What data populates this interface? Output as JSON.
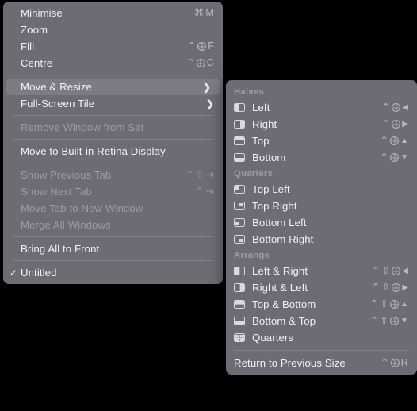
{
  "main_menu": {
    "groups": [
      {
        "items": [
          {
            "label": "Minimise",
            "shortcut": [
              "cmd",
              "M"
            ],
            "disabled": false,
            "checked": false,
            "submenu": false,
            "highlighted": false
          },
          {
            "label": "Zoom",
            "shortcut": [],
            "disabled": false,
            "checked": false,
            "submenu": false,
            "highlighted": false
          },
          {
            "label": "Fill",
            "shortcut": [
              "ctrl",
              "globe",
              "F"
            ],
            "disabled": false,
            "checked": false,
            "submenu": false,
            "highlighted": false
          },
          {
            "label": "Centre",
            "shortcut": [
              "ctrl",
              "globe",
              "C"
            ],
            "disabled": false,
            "checked": false,
            "submenu": false,
            "highlighted": false
          }
        ]
      },
      {
        "items": [
          {
            "label": "Move & Resize",
            "shortcut": [],
            "disabled": false,
            "checked": false,
            "submenu": true,
            "highlighted": true
          },
          {
            "label": "Full-Screen Tile",
            "shortcut": [],
            "disabled": false,
            "checked": false,
            "submenu": true,
            "highlighted": false
          }
        ]
      },
      {
        "items": [
          {
            "label": "Remove Window from Set",
            "shortcut": [],
            "disabled": true,
            "checked": false,
            "submenu": false,
            "highlighted": false
          }
        ]
      },
      {
        "items": [
          {
            "label": "Move to Built-in Retina Display",
            "shortcut": [],
            "disabled": false,
            "checked": false,
            "submenu": false,
            "highlighted": false
          }
        ]
      },
      {
        "items": [
          {
            "label": "Show Previous Tab",
            "shortcut": [
              "ctrl",
              "shift",
              "tab"
            ],
            "disabled": true,
            "checked": false,
            "submenu": false,
            "highlighted": false
          },
          {
            "label": "Show Next Tab",
            "shortcut": [
              "ctrl",
              "tab"
            ],
            "disabled": true,
            "checked": false,
            "submenu": false,
            "highlighted": false
          },
          {
            "label": "Move Tab to New Window",
            "shortcut": [],
            "disabled": true,
            "checked": false,
            "submenu": false,
            "highlighted": false
          },
          {
            "label": "Merge All Windows",
            "shortcut": [],
            "disabled": true,
            "checked": false,
            "submenu": false,
            "highlighted": false
          }
        ]
      },
      {
        "items": [
          {
            "label": "Bring All to Front",
            "shortcut": [],
            "disabled": false,
            "checked": false,
            "submenu": false,
            "highlighted": false
          }
        ]
      },
      {
        "items": [
          {
            "label": "Untitled",
            "shortcut": [],
            "disabled": false,
            "checked": true,
            "submenu": false,
            "highlighted": false
          }
        ]
      }
    ]
  },
  "submenu": {
    "sections": [
      {
        "header": "Halves",
        "items": [
          {
            "label": "Left",
            "icon": "window-left-half-icon",
            "shortcut": [
              "ctrl",
              "globe",
              "left"
            ]
          },
          {
            "label": "Right",
            "icon": "window-right-half-icon",
            "shortcut": [
              "ctrl",
              "globe",
              "right"
            ]
          },
          {
            "label": "Top",
            "icon": "window-top-half-icon",
            "shortcut": [
              "ctrl",
              "globe",
              "up"
            ]
          },
          {
            "label": "Bottom",
            "icon": "window-bottom-half-icon",
            "shortcut": [
              "ctrl",
              "globe",
              "down"
            ]
          }
        ]
      },
      {
        "header": "Quarters",
        "items": [
          {
            "label": "Top Left",
            "icon": "window-top-left-quarter-icon",
            "shortcut": []
          },
          {
            "label": "Top Right",
            "icon": "window-top-right-quarter-icon",
            "shortcut": []
          },
          {
            "label": "Bottom Left",
            "icon": "window-bottom-left-quarter-icon",
            "shortcut": []
          },
          {
            "label": "Bottom Right",
            "icon": "window-bottom-right-quarter-icon",
            "shortcut": []
          }
        ]
      },
      {
        "header": "Arrange",
        "items": [
          {
            "label": "Left & Right",
            "icon": "arrange-left-right-icon",
            "shortcut": [
              "ctrl",
              "shift",
              "globe",
              "left"
            ]
          },
          {
            "label": "Right & Left",
            "icon": "arrange-right-left-icon",
            "shortcut": [
              "ctrl",
              "shift",
              "globe",
              "right"
            ]
          },
          {
            "label": "Top & Bottom",
            "icon": "arrange-top-bottom-icon",
            "shortcut": [
              "ctrl",
              "shift",
              "globe",
              "up"
            ]
          },
          {
            "label": "Bottom & Top",
            "icon": "arrange-bottom-top-icon",
            "shortcut": [
              "ctrl",
              "shift",
              "globe",
              "down"
            ]
          },
          {
            "label": "Quarters",
            "icon": "arrange-quarters-icon",
            "shortcut": []
          }
        ]
      }
    ],
    "footer": {
      "label": "Return to Previous Size",
      "shortcut": [
        "ctrl",
        "globe",
        "R"
      ]
    }
  },
  "glyphs": {
    "cmd": "⌘",
    "ctrl": "⌃",
    "shift": "⇧",
    "tab": "⇥",
    "left": "◀",
    "right": "▶",
    "up": "▲",
    "down": "▼",
    "check": "✓",
    "chevron": "❯"
  },
  "colors": {
    "menu_background": "#6c6c74",
    "highlight": "#7c7c85",
    "text": "#f2f2f4",
    "text_disabled": "#9c9ca4",
    "header_text": "#9d9da6",
    "shortcut_text": "#b9b9c1",
    "separator": "#82828b",
    "page_background": "#000000",
    "icon_stroke": "#d8d8de"
  }
}
